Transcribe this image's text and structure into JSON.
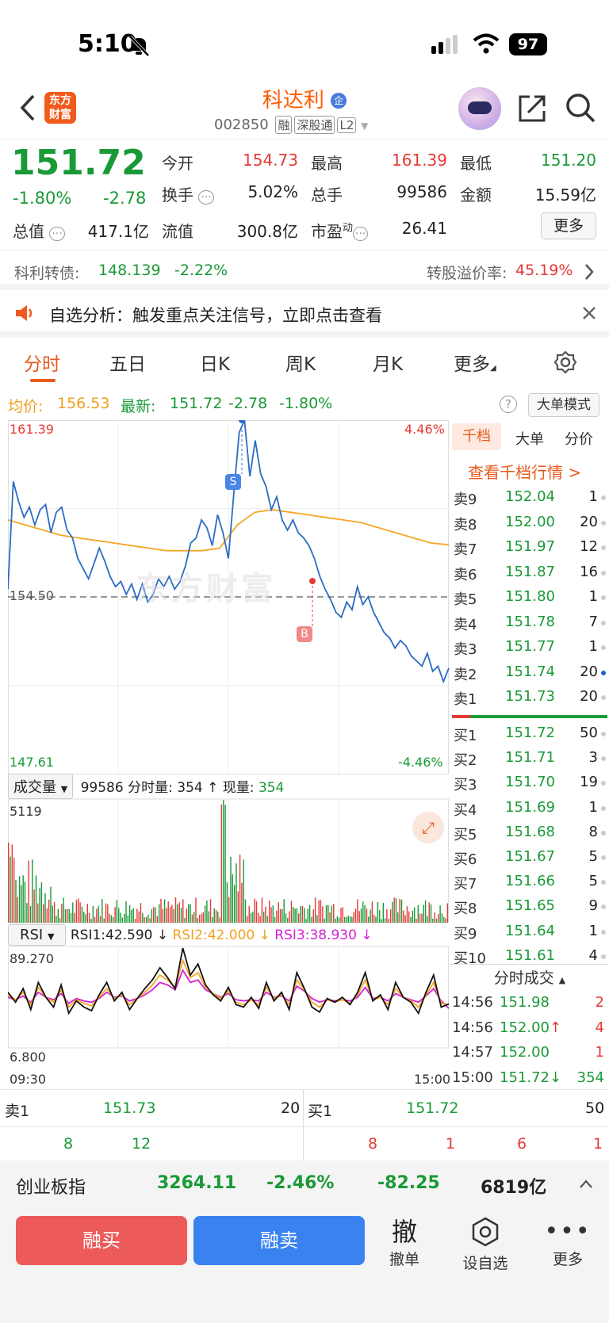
{
  "status_bar": {
    "time": "5:10",
    "battery": "97"
  },
  "header": {
    "logo_text": "东方财富",
    "stock_name": "科达利",
    "stock_code": "002850",
    "tags": [
      "融",
      "深股通",
      "L2"
    ]
  },
  "quote": {
    "price": "151.72",
    "change_pct": "-1.80%",
    "change": "-2.78",
    "open_label": "今开",
    "open": "154.73",
    "high_label": "最高",
    "high": "161.39",
    "low_label": "最低",
    "low": "151.20",
    "turnover_label": "换手",
    "turnover": "5.02%",
    "volume_label": "总手",
    "volume": "99586",
    "amount_label": "金额",
    "amount": "15.59亿",
    "mktcap_label": "总值",
    "mktcap": "417.1亿",
    "float_label": "流值",
    "float": "300.8亿",
    "pe_label": "市盈",
    "pe_sup": "动",
    "pe": "26.41",
    "more_label": "更多"
  },
  "bond": {
    "label": "科利转债:",
    "price": "148.139",
    "change": "-2.22%",
    "premium_label": "转股溢价率:",
    "premium": "45.19%"
  },
  "alert": {
    "text": "自选分析：触发重点关注信号，立即点击查看"
  },
  "tabs": [
    "分时",
    "五日",
    "日K",
    "周K",
    "月K",
    "更多"
  ],
  "price_line": {
    "avg_label": "均价:",
    "avg": "156.53",
    "latest_label": "最新:",
    "latest": "151.72",
    "change": "-2.78",
    "pct": "-1.80%",
    "mode_btn": "大单模式"
  },
  "chart_labels": {
    "top_price": "161.39",
    "top_pct": "4.46%",
    "mid_price": "154.50",
    "bottom_price": "147.61",
    "bottom_pct": "-4.46%",
    "marker_s": "S",
    "marker_b": "B",
    "watermark": "东方财富"
  },
  "volume_header": {
    "select": "成交量",
    "total": "99586",
    "label_tick": "分时量:",
    "tick": "354",
    "label_now": "现量:",
    "now": "354",
    "max": "5119"
  },
  "rsi_header": {
    "select": "RSI",
    "rsi1": "RSI1:42.590",
    "rsi2": "RSI2:42.000",
    "rsi3": "RSI3:38.930",
    "max": "89.270",
    "min": "6.800",
    "time_start": "09:30",
    "time_end": "15:00"
  },
  "colors": {
    "price_line": "#2b6cc4",
    "avg_line": "#f5a623",
    "rsi1": "#111111",
    "rsi2": "#f5a623",
    "rsi3": "#d41fd4",
    "up": "#e53935",
    "down": "#1a9a37"
  },
  "orderbook": {
    "tabs": [
      "千档",
      "大单",
      "分价"
    ],
    "link": "查看千档行情 >",
    "asks": [
      {
        "label": "卖9",
        "price": "152.04",
        "vol": "1"
      },
      {
        "label": "卖8",
        "price": "152.00",
        "vol": "20"
      },
      {
        "label": "卖7",
        "price": "151.97",
        "vol": "12"
      },
      {
        "label": "卖6",
        "price": "151.87",
        "vol": "16"
      },
      {
        "label": "卖5",
        "price": "151.80",
        "vol": "1"
      },
      {
        "label": "卖4",
        "price": "151.78",
        "vol": "7"
      },
      {
        "label": "卖3",
        "price": "151.77",
        "vol": "1"
      },
      {
        "label": "卖2",
        "price": "151.74",
        "vol": "20"
      },
      {
        "label": "卖1",
        "price": "151.73",
        "vol": "20"
      }
    ],
    "bids": [
      {
        "label": "买1",
        "price": "151.72",
        "vol": "50"
      },
      {
        "label": "买2",
        "price": "151.71",
        "vol": "3"
      },
      {
        "label": "买3",
        "price": "151.70",
        "vol": "19"
      },
      {
        "label": "买4",
        "price": "151.69",
        "vol": "1"
      },
      {
        "label": "买5",
        "price": "151.68",
        "vol": "8"
      },
      {
        "label": "买6",
        "price": "151.67",
        "vol": "5"
      },
      {
        "label": "买7",
        "price": "151.66",
        "vol": "5"
      },
      {
        "label": "买8",
        "price": "151.65",
        "vol": "9"
      },
      {
        "label": "买9",
        "price": "151.64",
        "vol": "1"
      },
      {
        "label": "买10",
        "price": "151.61",
        "vol": "4"
      }
    ],
    "trades_title": "分时成交",
    "trades": [
      {
        "time": "14:56",
        "price": "151.98",
        "vol": "2",
        "arrow": ""
      },
      {
        "time": "14:56",
        "price": "152.00",
        "vol": "4",
        "arrow": "↑"
      },
      {
        "time": "14:57",
        "price": "152.00",
        "vol": "1",
        "arrow": ""
      },
      {
        "time": "15:00",
        "price": "151.72",
        "vol": "354",
        "arrow": "↓"
      }
    ]
  },
  "bottom_quote": {
    "sell_label": "卖1",
    "sell_price": "151.73",
    "sell_vol": "20",
    "buy_label": "买1",
    "buy_price": "151.72",
    "buy_vol": "50"
  },
  "bottom_nums": {
    "left": [
      "8",
      "12"
    ],
    "right": [
      "8",
      "1",
      "6",
      "1"
    ]
  },
  "index": {
    "name": "创业板指",
    "value": "3264.11",
    "pct": "-2.46%",
    "change": "-82.25",
    "amount": "6819亿"
  },
  "actions": {
    "buy": "融买",
    "sell": "融卖",
    "cancel_icon": "撤",
    "cancel": "撤单",
    "watch": "设自选",
    "more": "更多"
  },
  "chart_data": {
    "type": "line",
    "x_range": [
      "09:30",
      "15:00"
    ],
    "ylim": [
      147.61,
      161.39
    ],
    "prev_close": 154.5,
    "series": [
      {
        "values": [
          154.8,
          159.0,
          158.2,
          157.6,
          158.0,
          157.3,
          157.9,
          158.1,
          157.0,
          157.8,
          158.0,
          157.1,
          156.8,
          156.0,
          155.6,
          155.2,
          155.8,
          156.4,
          155.9,
          155.3,
          154.9,
          155.1,
          154.6,
          155.0,
          154.4,
          155.0,
          154.3,
          154.6,
          155.2,
          154.9,
          155.3,
          154.8,
          155.1,
          155.7,
          156.6,
          156.8,
          157.5,
          157.2,
          156.5,
          157.7,
          157.0,
          156.0,
          158.5,
          160.9,
          161.39,
          159.2,
          160.6,
          159.3,
          158.8,
          157.9,
          158.4,
          157.5,
          157.1,
          157.5,
          157.0,
          156.8,
          156.5,
          156.0,
          155.3,
          154.8,
          154.4,
          153.9,
          153.7,
          154.3,
          154.0,
          154.9,
          154.2,
          154.5,
          153.9,
          153.5,
          153.1,
          152.9,
          152.5,
          152.8,
          152.6,
          152.2,
          152.0,
          151.8,
          152.3,
          151.6,
          151.8,
          151.2,
          151.72
        ]
      },
      {
        "values": [
          157.5,
          157.3,
          157.1,
          156.9,
          156.8,
          156.7,
          156.6,
          156.5,
          156.4,
          156.3,
          156.3,
          156.3,
          156.4,
          157.3,
          157.8,
          157.9,
          157.8,
          157.7,
          157.6,
          157.5,
          157.4,
          157.2,
          157.0,
          156.8,
          156.6,
          156.53
        ]
      }
    ],
    "rsi": [
      {
        "name": "RSI1",
        "values": [
          52,
          44,
          55,
          38,
          60,
          48,
          40,
          58,
          35,
          45,
          40,
          37,
          50,
          60,
          45,
          52,
          38,
          47,
          55,
          62,
          72,
          64,
          55,
          88,
          66,
          75,
          58,
          50,
          45,
          56,
          42,
          40,
          48,
          39,
          60,
          45,
          52,
          38,
          68,
          55,
          40,
          36,
          47,
          44,
          48,
          42,
          52,
          68,
          45,
          50,
          38,
          60,
          48,
          44,
          35,
          52,
          66,
          40,
          42.59
        ]
      },
      {
        "name": "RSI2",
        "values": [
          50,
          46,
          52,
          42,
          56,
          48,
          44,
          54,
          40,
          46,
          43,
          41,
          48,
          55,
          47,
          50,
          42,
          47,
          52,
          58,
          66,
          62,
          56,
          78,
          64,
          68,
          56,
          51,
          47,
          53,
          44,
          42,
          46,
          42,
          56,
          47,
          50,
          42,
          62,
          54,
          44,
          40,
          46,
          44,
          46,
          43,
          50,
          62,
          46,
          48,
          42,
          55,
          48,
          45,
          40,
          50,
          60,
          43,
          42.0
        ]
      },
      {
        "name": "RSI3",
        "values": [
          48,
          46,
          49,
          44,
          52,
          48,
          46,
          51,
          43,
          47,
          45,
          44,
          47,
          52,
          48,
          49,
          45,
          47,
          50,
          54,
          60,
          58,
          54,
          70,
          60,
          62,
          54,
          51,
          48,
          51,
          46,
          45,
          46,
          45,
          52,
          48,
          49,
          45,
          57,
          53,
          47,
          44,
          46,
          45,
          46,
          45,
          48,
          56,
          47,
          48,
          45,
          51,
          48,
          46,
          44,
          49,
          55,
          45,
          38.93
        ]
      }
    ],
    "rsi_ylim": [
      6.8,
      89.27
    ],
    "volume_max": 5119
  }
}
